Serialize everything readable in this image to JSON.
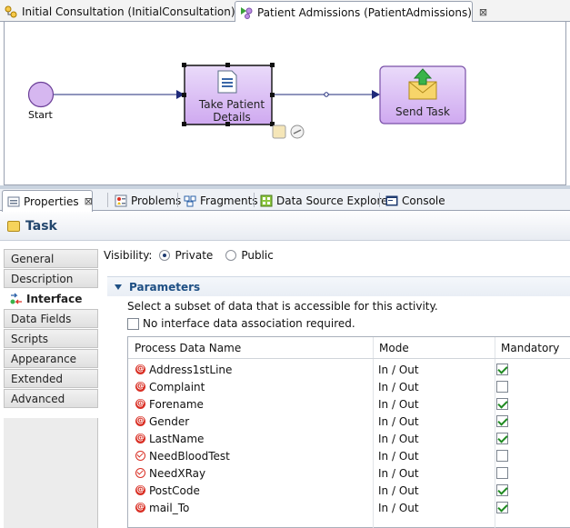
{
  "editor_tabs": [
    {
      "label": "Initial Consultation (InitialConsultation)",
      "icon": "process-icon"
    },
    {
      "label": "Patient Admissions (PatientAdmissions)",
      "icon": "process-icon",
      "close": "⊠"
    }
  ],
  "diagram": {
    "start_label": "Start",
    "task1_label": "Take Patient Details",
    "task2_label": "Send Task"
  },
  "view_tabs": [
    {
      "label": "Properties",
      "icon": "properties-icon",
      "close": "⊠"
    },
    {
      "label": "Problems",
      "icon": "problems-icon"
    },
    {
      "label": "Fragments",
      "icon": "fragments-icon"
    },
    {
      "label": "Data Source Explorer",
      "icon": "datasource-icon"
    },
    {
      "label": "Console",
      "icon": "console-icon"
    }
  ],
  "panel_title": "Task",
  "nav": {
    "items": [
      {
        "label": "General"
      },
      {
        "label": "Description"
      },
      {
        "label": "Interface"
      },
      {
        "label": "Data Fields"
      },
      {
        "label": "Scripts"
      },
      {
        "label": "Appearance"
      },
      {
        "label": "Extended"
      },
      {
        "label": "Advanced"
      }
    ],
    "active_index": 2
  },
  "visibility": {
    "label": "Visibility:",
    "options": [
      "Private",
      "Public"
    ],
    "selected": "Private"
  },
  "parameters": {
    "title": "Parameters",
    "description": "Select a subset of data that is accessible for this activity.",
    "no_assoc_label": "No interface data association required.",
    "no_assoc_checked": false,
    "columns": [
      "Process Data Name",
      "Mode",
      "Mandatory"
    ],
    "rows": [
      {
        "name": "Address1stLine",
        "type": "text",
        "mode": "In / Out",
        "mandatory": true
      },
      {
        "name": "Complaint",
        "type": "text",
        "mode": "In / Out",
        "mandatory": false
      },
      {
        "name": "Forename",
        "type": "text",
        "mode": "In / Out",
        "mandatory": true
      },
      {
        "name": "Gender",
        "type": "text",
        "mode": "In / Out",
        "mandatory": true
      },
      {
        "name": "LastName",
        "type": "text",
        "mode": "In / Out",
        "mandatory": true
      },
      {
        "name": "NeedBloodTest",
        "type": "boolean",
        "mode": "In / Out",
        "mandatory": false
      },
      {
        "name": "NeedXRay",
        "type": "boolean",
        "mode": "In / Out",
        "mandatory": false
      },
      {
        "name": "PostCode",
        "type": "text",
        "mode": "In / Out",
        "mandatory": true
      },
      {
        "name": "mail_To",
        "type": "text",
        "mode": "In / Out",
        "mandatory": true
      }
    ]
  },
  "colors": {
    "task_fill": "#dcc3f3",
    "task_border": "#7a51a8",
    "flow_line": "#1f2a7a",
    "accent_blue": "#1e4f84"
  }
}
